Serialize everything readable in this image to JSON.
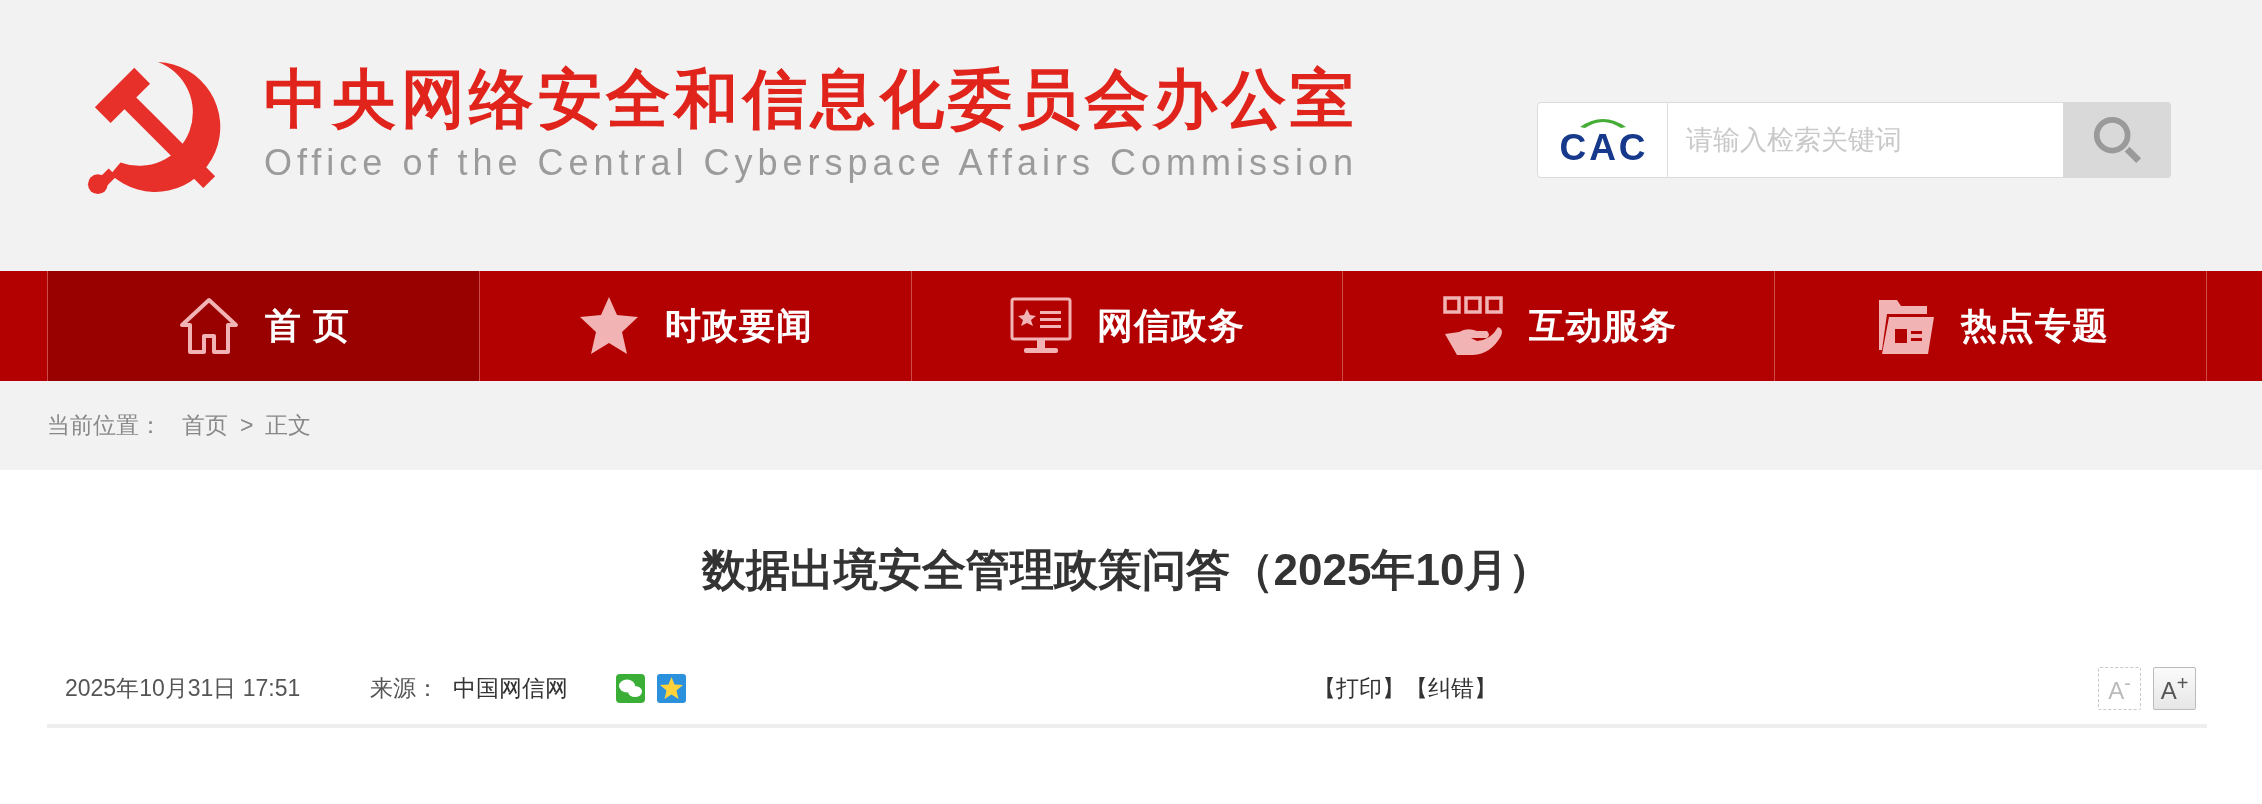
{
  "header": {
    "title": "中央网络安全和信息化委员会办公室",
    "subtitle": "Office of the Central Cyberspace Affairs Commission",
    "search": {
      "logo": "CAC",
      "placeholder": "请输入检索关键词"
    }
  },
  "nav": [
    {
      "kind": "home",
      "label": "首 页",
      "selected": true
    },
    {
      "kind": "star",
      "label": "时政要闻",
      "selected": false
    },
    {
      "kind": "screen",
      "label": "网信政务",
      "selected": false
    },
    {
      "kind": "hand",
      "label": "互动服务",
      "selected": false
    },
    {
      "kind": "folder",
      "label": "热点专题",
      "selected": false
    }
  ],
  "breadcrumb": {
    "label": "当前位置：",
    "separator": ">",
    "items": [
      "首页",
      "正文"
    ]
  },
  "article": {
    "title": "数据出境安全管理政策问答（2025年10月）",
    "date": "2025年10月31日 17:51",
    "source_label": "来源：",
    "source": "中国网信网",
    "share": [
      {
        "kind": "chat"
      },
      {
        "kind": "star"
      }
    ],
    "actions": [
      "【打印】",
      "【纠错】"
    ],
    "font_buttons": [
      {
        "label": "A$^{-}$",
        "disabled": true
      },
      {
        "label": "A$^{+}$",
        "disabled": false
      }
    ]
  }
}
